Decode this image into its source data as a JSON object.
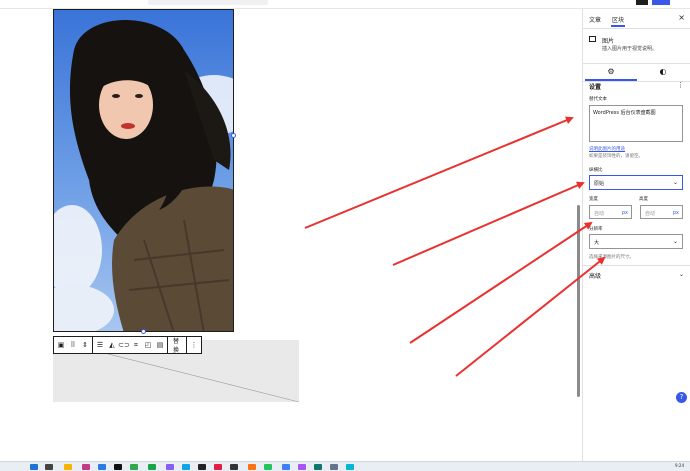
{
  "colors": {
    "accent": "#3858e9",
    "arrow": "#e8322f"
  },
  "sidebar": {
    "tabs": [
      {
        "label": "文章"
      },
      {
        "label": "区块"
      }
    ],
    "close_icon": "×",
    "block": {
      "title": "图片",
      "description": "插入图片用于视觉说明。"
    },
    "subtabs": {
      "settings_icon": "gear-icon",
      "styles_icon": "half-circle-icon"
    },
    "settings": {
      "section_title": "设置",
      "alt_label": "替代文本",
      "alt_value": "WordPress 后台仪表盘截图",
      "alt_link": "说明此图片的用途",
      "alt_help": "如果是装饰性的，请留空。",
      "aspect_label": "纵横比",
      "aspect_value": "原始",
      "width_label": "宽度",
      "height_label": "高度",
      "width_placeholder": "自动",
      "height_placeholder": "自动",
      "unit": "px",
      "resolution_label": "分辨率",
      "resolution_value": "大",
      "resolution_help": "选择来源图片的尺寸。"
    },
    "advanced_label": "高级"
  },
  "toolbar": {
    "replace_label": "替换"
  },
  "taskbar": {
    "time": "9:24"
  }
}
